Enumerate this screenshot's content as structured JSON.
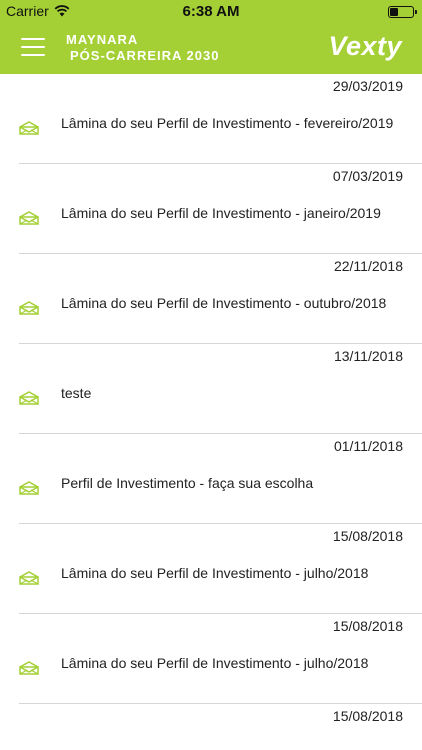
{
  "statusbar": {
    "carrier": "Carrier",
    "time": "6:38 AM"
  },
  "header": {
    "user_name": "MAYNARA",
    "plan_name": "PÓS-CARREIRA 2030",
    "logo": "Vexty"
  },
  "messages": [
    {
      "date": "29/03/2019",
      "title": "Lâmina do seu Perfil de Investimento - fevereiro/2019",
      "icon": "envelope-open-icon"
    },
    {
      "date": "07/03/2019",
      "title": "Lâmina do seu Perfil de Investimento - janeiro/2019",
      "icon": "envelope-open-icon"
    },
    {
      "date": "22/11/2018",
      "title": "Lâmina do seu Perfil de Investimento - outubro/2018",
      "icon": "envelope-open-icon"
    },
    {
      "date": "13/11/2018",
      "title": "teste",
      "icon": "envelope-open-icon"
    },
    {
      "date": "01/11/2018",
      "title": "Perfil de Investimento - faça sua escolha",
      "icon": "envelope-open-icon"
    },
    {
      "date": "15/08/2018",
      "title": "Lâmina do seu Perfil de Investimento - julho/2018",
      "icon": "envelope-open-icon"
    },
    {
      "date": "15/08/2018",
      "title": "Lâmina do seu Perfil de Investimento - julho/2018",
      "icon": "envelope-open-icon"
    }
  ],
  "trailing_date": "15/08/2018",
  "colors": {
    "brand": "#a4d035",
    "divider": "#d6d6d6"
  }
}
